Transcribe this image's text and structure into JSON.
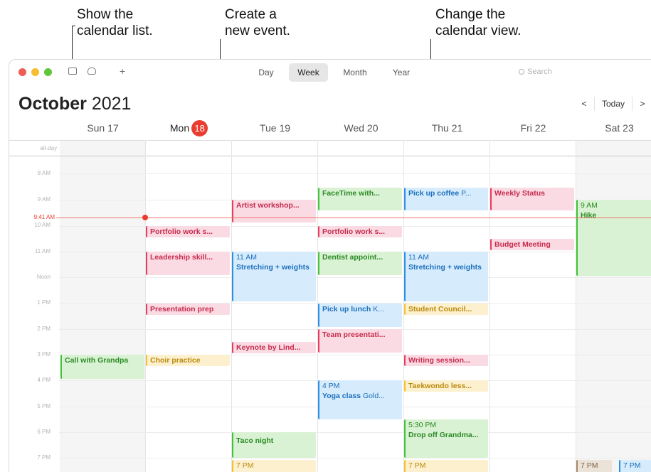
{
  "annotations": {
    "calendar_list": "Show the\ncalendar list.",
    "new_event": "Create a\nnew event.",
    "change_view": "Change the\ncalendar view."
  },
  "toolbar": {
    "calendar_list_icon": "calendar-list-icon",
    "inbox_icon": "inbox-icon",
    "add_icon": "plus-icon",
    "add_glyph": "+",
    "views": [
      "Day",
      "Week",
      "Month",
      "Year"
    ],
    "selected_view": "Week",
    "search_placeholder": "Search"
  },
  "header": {
    "month": "October",
    "year": "2021",
    "prev_glyph": "<",
    "today_label": "Today",
    "next_glyph": ">"
  },
  "days": [
    {
      "label": "Sun 17"
    },
    {
      "label": "Mon",
      "badge": "18"
    },
    {
      "label": "Tue 19"
    },
    {
      "label": "Wed 20"
    },
    {
      "label": "Thu 21"
    },
    {
      "label": "Fri 22"
    },
    {
      "label": "Sat 23"
    }
  ],
  "all_day_label": "all-day",
  "hours": [
    "8 AM",
    "9 AM",
    "10 AM",
    "11 AM",
    "Noon",
    "1 PM",
    "2 PM",
    "3 PM",
    "4 PM",
    "5 PM",
    "6 PM",
    "7 PM"
  ],
  "current_time": "9:41 AM",
  "events": [
    {
      "title": "FaceTime with...",
      "color": "green"
    },
    {
      "title": "Pick up coffee",
      "location": "P...",
      "color": "blue"
    },
    {
      "title": "Weekly Status",
      "color": "red"
    },
    {
      "title": "Artist workshop...",
      "color": "red"
    },
    {
      "time": "9 AM",
      "title": "Hike",
      "color": "green"
    },
    {
      "title": "Portfolio work s...",
      "color": "red"
    },
    {
      "title": "Portfolio work s...",
      "color": "red"
    },
    {
      "title": "Budget Meeting",
      "color": "red"
    },
    {
      "title": "Leadership skill...",
      "color": "red"
    },
    {
      "time": "11 AM",
      "title": "Stretching + weights",
      "color": "blue"
    },
    {
      "title": "Dentist appoint...",
      "color": "green"
    },
    {
      "time": "11 AM",
      "title": "Stretching + weights",
      "color": "blue"
    },
    {
      "title": "Presentation prep",
      "color": "red"
    },
    {
      "title": "Pick up lunch",
      "location": "K...",
      "color": "blue"
    },
    {
      "title": "Student Council...",
      "color": "yellow"
    },
    {
      "title": "Team presentati...",
      "color": "red"
    },
    {
      "title": "Keynote by Lind...",
      "color": "red"
    },
    {
      "title": "Call with Grandpa",
      "color": "green"
    },
    {
      "title": "Choir practice",
      "color": "yellow"
    },
    {
      "title": "Writing session...",
      "color": "red"
    },
    {
      "title": "Taekwondo less...",
      "color": "yellow"
    },
    {
      "time": "4 PM",
      "title": "Yoga class",
      "location": "Gold...",
      "color": "blue"
    },
    {
      "time": "5:30 PM",
      "title": "Drop off Grandma...",
      "color": "green"
    },
    {
      "title": "Taco night",
      "color": "green"
    },
    {
      "title": "7 PM",
      "color": "yellow"
    },
    {
      "title": "7 PM",
      "color": "yellow"
    },
    {
      "title": "7 PM",
      "color": "brown"
    },
    {
      "title": "7 PM",
      "color": "blue"
    }
  ]
}
